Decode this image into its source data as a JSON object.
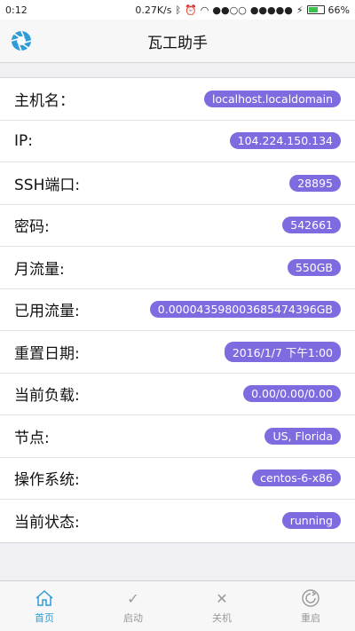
{
  "status_bar": {
    "time": "0:12",
    "net_speed": "0.27K/s",
    "battery_text": "66%",
    "battery_level": 0.66
  },
  "header": {
    "title": "瓦工助手",
    "logo_icon": "aperture-icon"
  },
  "rows": [
    {
      "label": "主机名：",
      "value": "localhost.localdomain"
    },
    {
      "label": "IP:",
      "value": "104.224.150.134"
    },
    {
      "label": "SSH端口:",
      "value": "28895"
    },
    {
      "label": "密码:",
      "value": "542661"
    },
    {
      "label": "月流量:",
      "value": "550GB"
    },
    {
      "label": "已用流量:",
      "value": "0.000043598003685474396GB"
    },
    {
      "label": "重置日期:",
      "value": "2016/1/7 下午1:00"
    },
    {
      "label": "当前负载:",
      "value": "0.00/0.00/0.00"
    },
    {
      "label": "节点:",
      "value": "US, Florida"
    },
    {
      "label": "操作系统:",
      "value": "centos-6-x86"
    },
    {
      "label": "当前状态:",
      "value": "running"
    }
  ],
  "tabs": [
    {
      "label": "首页",
      "icon": "home-icon",
      "active": true
    },
    {
      "label": "启动",
      "icon": "check-icon",
      "active": false
    },
    {
      "label": "关机",
      "icon": "close-icon",
      "active": false
    },
    {
      "label": "重启",
      "icon": "restart-icon",
      "active": false
    }
  ],
  "colors": {
    "accent": "#2f9bd9",
    "badge": "#7e6be0"
  }
}
